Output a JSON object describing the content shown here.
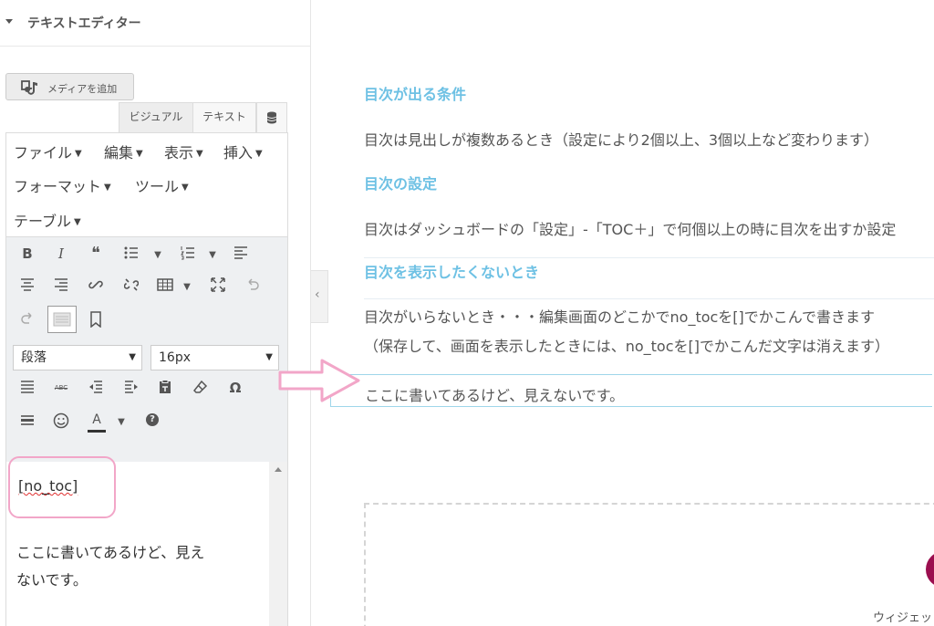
{
  "panel": {
    "title": "テキストエディター",
    "add_media_label": "メディアを追加",
    "tabs": {
      "visual": "ビジュアル",
      "text": "テキスト"
    }
  },
  "menubar": {
    "row1": [
      "ファイル",
      "編集",
      "表示",
      "挿入"
    ],
    "row2": [
      "フォーマット",
      "ツール"
    ],
    "row3": [
      "テーブル"
    ]
  },
  "toolbar": {
    "icons": {
      "row1": [
        "bold-icon",
        "italic-icon",
        "blockquote-icon",
        "bullet-list-icon",
        "numbered-list-icon",
        "align-left-icon"
      ],
      "row2": [
        "align-center-icon",
        "align-right-icon",
        "link-icon",
        "unlink-icon",
        "table-icon",
        "fullscreen-icon",
        "undo-icon"
      ],
      "row3": [
        "redo-icon",
        "toolbar-toggle-icon",
        "bookmark-icon"
      ],
      "row4": [
        "justify-icon",
        "strikethrough-icon",
        "outdent-icon",
        "indent-icon",
        "paste-text-icon",
        "eraser-icon",
        "omega-icon"
      ],
      "row5": [
        "horizontal-rule-icon",
        "emoji-icon",
        "text-color-icon",
        "help-icon"
      ]
    },
    "bold": "B",
    "italic": "I",
    "quote": "❝",
    "text_color": "A",
    "omega": "Ω",
    "help": "?",
    "strike": "ABC",
    "format_select": "段落",
    "size_select": "16px"
  },
  "editor": {
    "shortcode": "[no_toc]",
    "line1": "ここに書いてあるけど、見え",
    "line2": "ないです。"
  },
  "preview": {
    "heading1": "目次が出る条件",
    "para1": "目次は見出しが複数あるとき（設定により2個以上、3個以上など変わります）",
    "heading2": "目次の設定",
    "para2": "目次はダッシュボードの「設定」-「TOC＋」で何個以上の時に目次を出すか設定",
    "heading3": "目次を表示したくないとき",
    "para3_line1": "目次がいらないとき・・・編集画面のどこかでno_tocを[]でかこんで書きます",
    "para3_line2": "（保存して、画面を表示したときには、no_tocを[]でかこんだ文字は消えます）",
    "hidden_text": "ここに書いてあるけど、見えないです。",
    "widget_label": "ウィジェット"
  },
  "colors": {
    "heading": "#6ec1e4",
    "highlight": "#f2a6c8",
    "arrow": "#f2a6c8",
    "selection": "#9fd6ea",
    "widget_accent": "#9b0e4f"
  }
}
